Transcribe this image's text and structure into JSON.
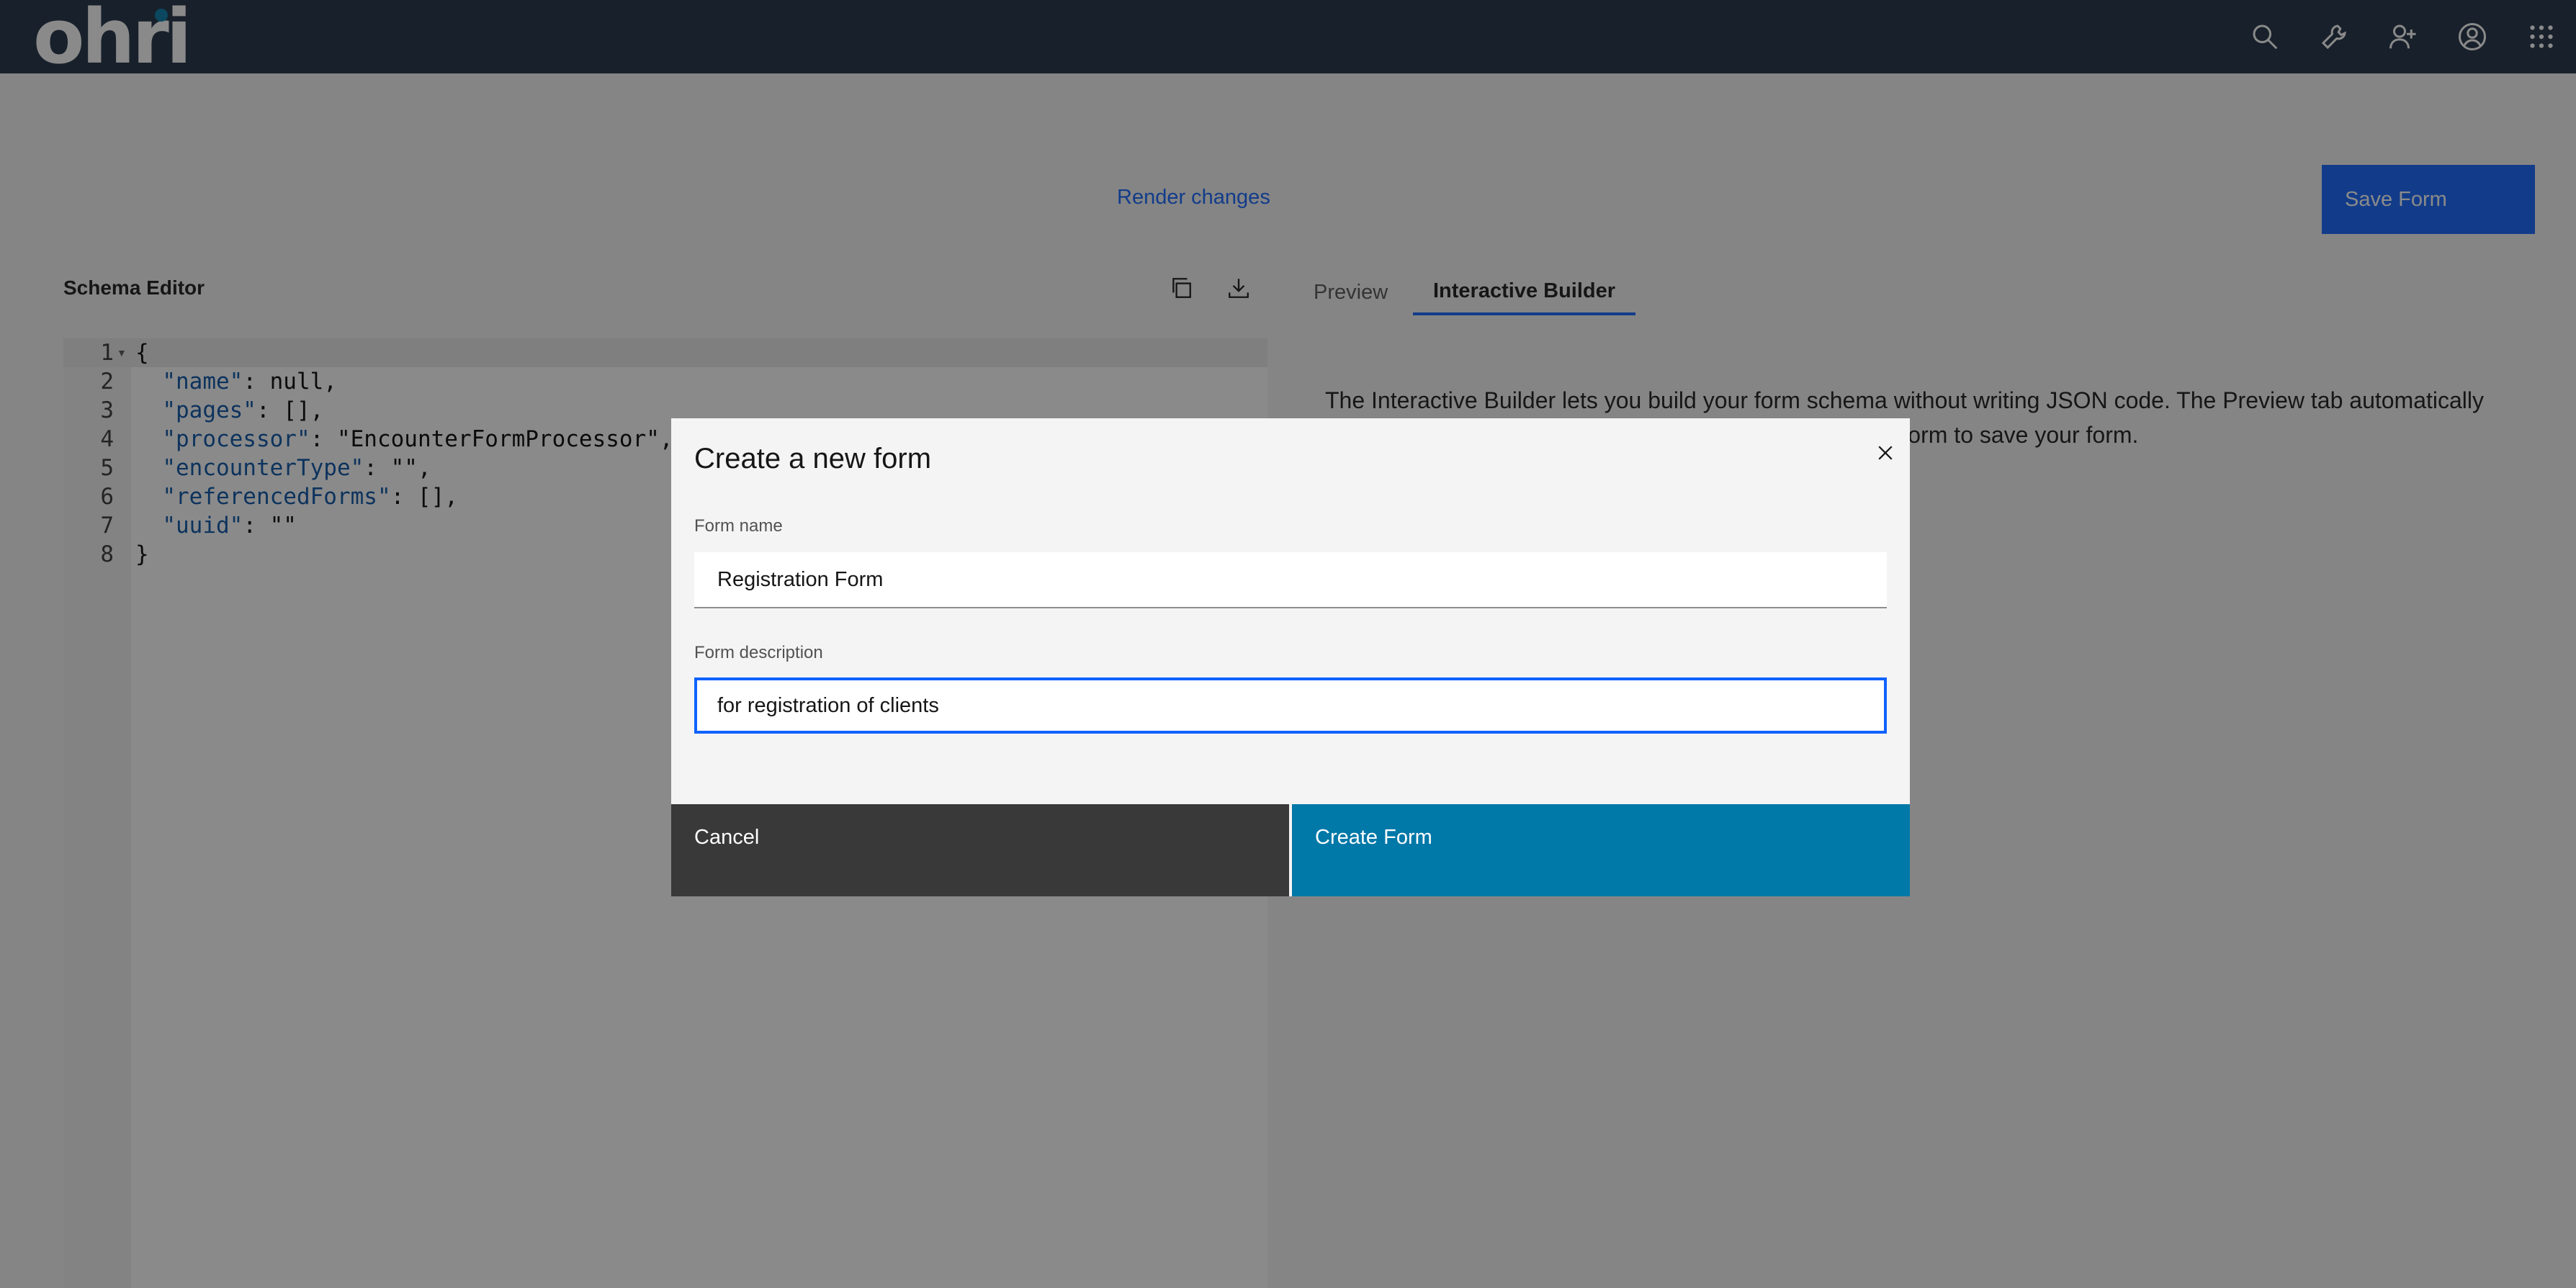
{
  "header": {
    "logo_text": "ohri",
    "icons": [
      "search-icon",
      "wrench-icon",
      "add-user-icon",
      "user-avatar-icon",
      "app-switcher-icon"
    ]
  },
  "toolbar": {
    "render_label": "Render changes",
    "save_label": "Save Form"
  },
  "schema_editor": {
    "title": "Schema Editor",
    "tools": [
      "copy-icon",
      "download-icon"
    ],
    "lines": [
      {
        "num": "1",
        "text": "{"
      },
      {
        "num": "2",
        "key": "\"name\"",
        "rest": ": null,"
      },
      {
        "num": "3",
        "key": "\"pages\"",
        "rest": ": [],"
      },
      {
        "num": "4",
        "key": "\"processor\"",
        "rest": ": \"EncounterFormProcessor\","
      },
      {
        "num": "5",
        "key": "\"encounterType\"",
        "rest": ": \"\","
      },
      {
        "num": "6",
        "key": "\"referencedForms\"",
        "rest": ": [],"
      },
      {
        "num": "7",
        "key": "\"uuid\"",
        "rest": ": \"\""
      },
      {
        "num": "8",
        "text": "}"
      }
    ]
  },
  "right_panel": {
    "tabs": [
      {
        "label": "Preview",
        "selected": false
      },
      {
        "label": "Interactive Builder",
        "selected": true
      }
    ],
    "description": "The Interactive Builder lets you build your form schema without writing JSON code. The Preview tab automatically updates as you build your form. When done, click Save Form to save your form."
  },
  "modal": {
    "title": "Create a new form",
    "form_name_label": "Form name",
    "form_name_value": "Registration Form",
    "form_description_label": "Form description",
    "form_description_value": "for registration of clients",
    "cancel_label": "Cancel",
    "create_label": "Create Form"
  },
  "colors": {
    "header_bg": "#1b2a41",
    "primary": "#0f62fe",
    "create_button": "#0078a8",
    "cancel_button": "#393939"
  }
}
